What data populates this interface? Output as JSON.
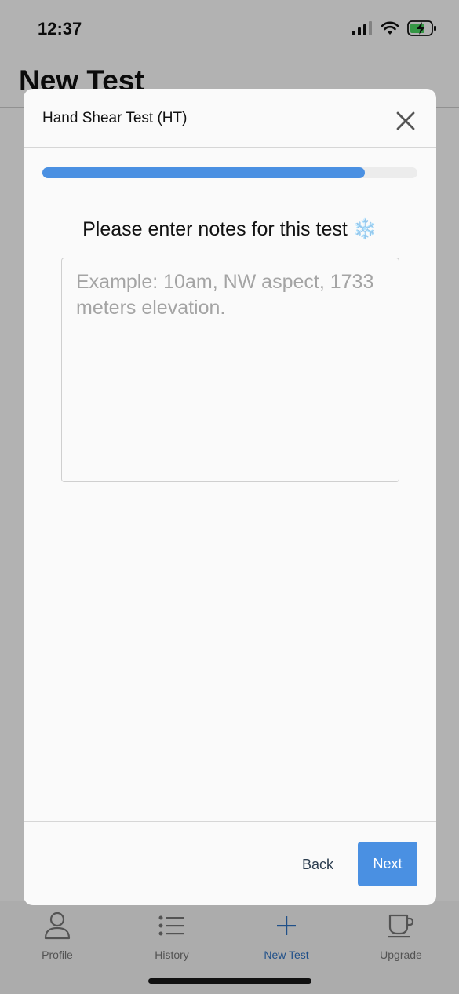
{
  "status_bar": {
    "time": "12:37"
  },
  "page": {
    "title": "New Test"
  },
  "tab_bar": {
    "items": [
      {
        "label": "Profile",
        "icon": "person-icon",
        "active": false
      },
      {
        "label": "History",
        "icon": "list-icon",
        "active": false
      },
      {
        "label": "New Test",
        "icon": "plus-icon",
        "active": true
      },
      {
        "label": "Upgrade",
        "icon": "coffee-cup-icon",
        "active": false
      }
    ],
    "active_color": "#2f73c5"
  },
  "modal": {
    "title": "Hand Shear Test (HT)",
    "progress_fraction": 0.86,
    "prompt": "Please enter notes for this test ❄️",
    "notes": {
      "value": "",
      "placeholder": "Example: 10am, NW aspect, 1733 meters elevation."
    },
    "back_label": "Back",
    "next_label": "Next",
    "accent_color": "#4a90e2"
  }
}
